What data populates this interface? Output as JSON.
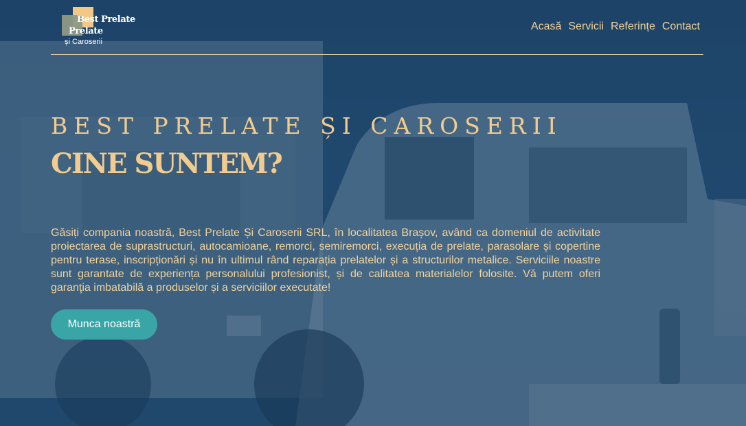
{
  "logo": {
    "line1": "Best Prelate",
    "line2": "Prelate",
    "line3": "și Caroserii"
  },
  "nav": {
    "items": [
      "Acasă",
      "Servicii",
      "Referințe",
      "Contact"
    ]
  },
  "hero": {
    "kicker": "BEST PRELATE ȘI CAROSERII",
    "title": "CINE SUNTEM?",
    "description": "Găsiți compania noastră, Best Prelate Și Caroserii SRL, în localitatea Brașov, având ca domeniul de activitate proiectarea de suprastructuri, autocamioane, remorci, semiremorci, execuția de prelate, parasolare și copertine pentru terase, inscripționări și nu în ultimul rând reparația prelatelor și a structurilor metalice. Serviciile noastre sunt garantate de experiența personalului profesionist, și de calitatea materialelor folosite. Vă putem oferi garanţia imbatabilă a produselor și a serviciilor executate!",
    "cta_label": "Munca noastră"
  },
  "colors": {
    "accent_gold": "#f2cc8f",
    "button_teal": "#3aa5a7",
    "overlay_blue": "#1a4268"
  }
}
